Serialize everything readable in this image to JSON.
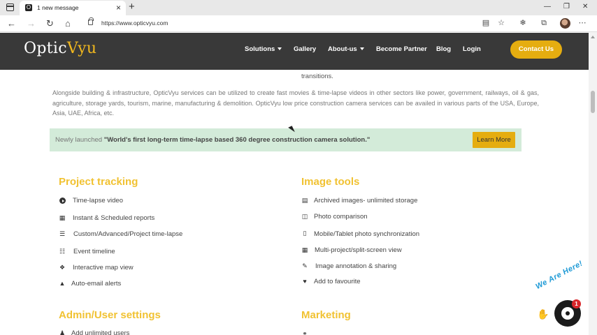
{
  "browser": {
    "tab_title": "1 new message",
    "tab_favicon": "O",
    "url": "https://www.opticvyu.com",
    "new_tab": "+",
    "tab_close": "×"
  },
  "header": {
    "logo_optic": "Optic",
    "logo_vyu": "Vyu",
    "nav": {
      "solutions": "Solutions",
      "gallery": "Gallery",
      "about": "About-us",
      "partner": "Become Partner",
      "blog": "Blog",
      "login": "Login"
    },
    "contact": "Contact Us"
  },
  "content": {
    "transitions": "transitions.",
    "paragraph": "Alongside building & infrastructure, OpticVyu services can be utilized to create fast movies & time-lapse videos in other sectors like power, government, railways, oil & gas, agriculture, storage yards, tourism, marine, manufacturing & demolition. OpticVyu low price construction camera services can be availed in various parts of the USA, Europe, Asia, UAE, Africa, etc.",
    "banner": {
      "prefix": "Newly launched ",
      "highlight": "\"World's first long-term time-lapse based 360 degree construction camera solution.\"",
      "button": "Learn More"
    }
  },
  "sections": {
    "project_tracking": {
      "title": "Project tracking",
      "items": [
        "Time-lapse video",
        "Instant & Scheduled reports",
        "Custom/Advanced/Project time-lapse",
        "Event timeline",
        "Interactive map view",
        "Auto-email alerts"
      ]
    },
    "image_tools": {
      "title": "Image tools",
      "items": [
        "Archived images- unlimited storage",
        "Photo comparison",
        "Mobile/Tablet photo synchronization",
        "Multi-project/split-screen view",
        "Image annotation & sharing",
        "Add to favourite"
      ]
    },
    "admin": {
      "title": "Admin/User settings",
      "items": [
        "Add unlimited users"
      ]
    },
    "marketing": {
      "title": "Marketing"
    }
  },
  "chat": {
    "badge": "We Are Here!",
    "count": "1"
  },
  "colors": {
    "accent": "#e5ad10",
    "section_title": "#f1c232",
    "banner_bg": "#d3ebd9",
    "header_bg": "#282828"
  }
}
